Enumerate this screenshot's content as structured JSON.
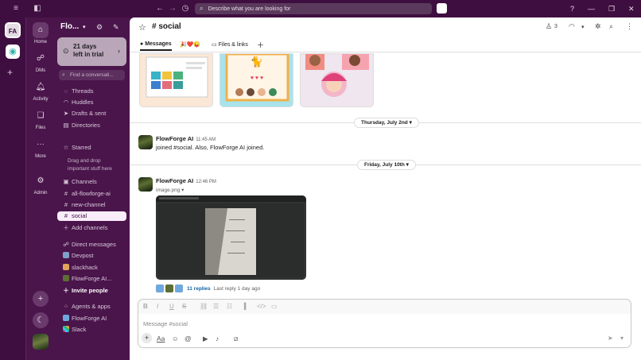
{
  "window": {
    "search_placeholder": "Describe what you are looking for"
  },
  "rail": {
    "workspace_initials": "FA"
  },
  "nav": {
    "items": [
      {
        "label": "Home"
      },
      {
        "label": "DMs"
      },
      {
        "label": "Activity"
      },
      {
        "label": "Files"
      },
      {
        "label": "More"
      },
      {
        "label": "Admin"
      }
    ]
  },
  "sidebar": {
    "workspace_name": "Flo...",
    "trial_line1": "21 days",
    "trial_line2": "left in trial",
    "find_placeholder": "Find a conversati...",
    "top_items": [
      "Threads",
      "Huddles",
      "Drafts & sent",
      "Directories"
    ],
    "starred_label": "Starred",
    "starred_hint": "Drag and drop important stuff here",
    "channels_label": "Channels",
    "channels": [
      "all-flowforge-ai",
      "new-channel",
      "social"
    ],
    "add_channels": "Add channels",
    "dms_label": "Direct messages",
    "dms": [
      "Devpost",
      "slackhack",
      "FlowForge AI..."
    ],
    "invite_people": "Invite people",
    "apps_label": "Agents & apps",
    "apps": [
      "FlowForge AI",
      "Slack"
    ]
  },
  "channel": {
    "name": "# social",
    "member_count": "3",
    "tabs": {
      "messages": "Messages",
      "files": "Files & links"
    }
  },
  "messages": {
    "date1": "Thursday, July 2nd",
    "msg1_author": "FlowForge AI",
    "msg1_time": "11:45 AM",
    "msg1_text": "joined #social. Also, FlowForge AI joined.",
    "date2": "Friday, July 10th",
    "msg2_author": "FlowForge AI",
    "msg2_time": "12:46 PM",
    "msg2_file": "image.png",
    "replies_count": "11 replies",
    "replies_last": "Last reply 1 day ago"
  },
  "composer": {
    "placeholder": "Message #social"
  }
}
